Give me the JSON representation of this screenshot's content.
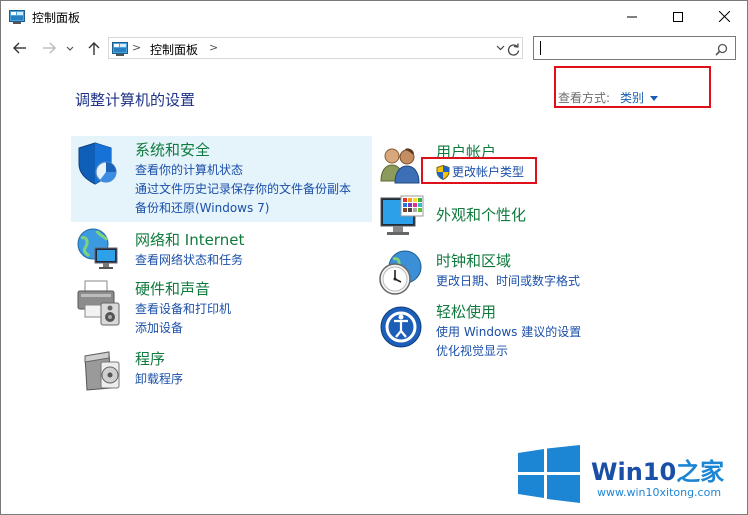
{
  "window": {
    "title": "控制面板"
  },
  "address": {
    "crumb": "控制面板",
    "separator": ">",
    "separator2": ">"
  },
  "search": {
    "placeholder": ""
  },
  "main": {
    "heading": "调整计算机的设置",
    "view_by_label": "查看方式:",
    "view_by_value": "类别"
  },
  "categories": {
    "system": {
      "title": "系统和安全",
      "links": [
        "查看你的计算机状态",
        "通过文件历史记录保存你的文件备份副本",
        "备份和还原(Windows 7)"
      ]
    },
    "network": {
      "title": "网络和 Internet",
      "links": [
        "查看网络状态和任务"
      ]
    },
    "hardware": {
      "title": "硬件和声音",
      "links": [
        "查看设备和打印机",
        "添加设备"
      ]
    },
    "programs": {
      "title": "程序",
      "links": [
        "卸载程序"
      ]
    },
    "users": {
      "title": "用户帐户",
      "links": [
        "更改帐户类型"
      ]
    },
    "appearance": {
      "title": "外观和个性化",
      "links": []
    },
    "clock": {
      "title": "时钟和区域",
      "links": [
        "更改日期、时间或数字格式"
      ]
    },
    "ease": {
      "title": "轻松使用",
      "links": [
        "使用 Windows 建议的设置",
        "优化视觉显示"
      ]
    }
  },
  "watermark": {
    "brand": "Win10",
    "suffix": "之家",
    "url": "www.win10xitong.com"
  },
  "colors": {
    "highlight_box": "#e0101a",
    "link": "#1a4fa8",
    "category_title": "#0f7a3d",
    "heading": "#1e3287"
  }
}
